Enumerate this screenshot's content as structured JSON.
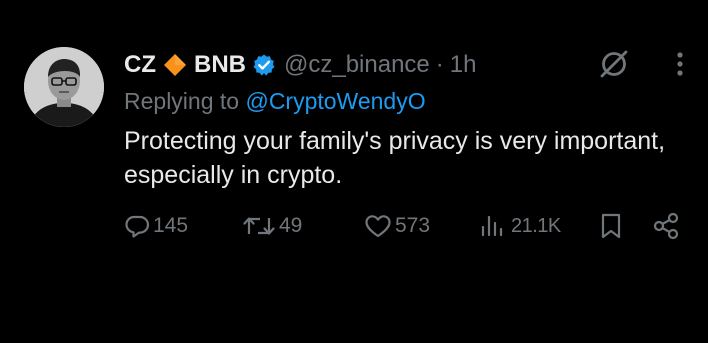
{
  "tweet": {
    "author": {
      "display_name": "CZ",
      "name_suffix": "BNB",
      "handle": "@cz_binance",
      "separator": "·",
      "time": "1h",
      "avatar_icon": "avatar-photo",
      "badge_icon": "verified-badge-icon",
      "emoji_icon": "orange-diamond-icon"
    },
    "replying_to": {
      "prefix": "Replying to",
      "mention": "@CryptoWendyO"
    },
    "text": "Protecting your family's privacy is very important, especially in crypto.",
    "actions": {
      "replies": "145",
      "retweets": "49",
      "likes": "573",
      "views": "21.1K"
    }
  },
  "colors": {
    "background": "#000000",
    "primary_text": "#e7e9ea",
    "secondary_text": "#71767b",
    "link": "#1d9bf0",
    "verified": "#1d9bf0",
    "diamond": "#f7931a"
  }
}
